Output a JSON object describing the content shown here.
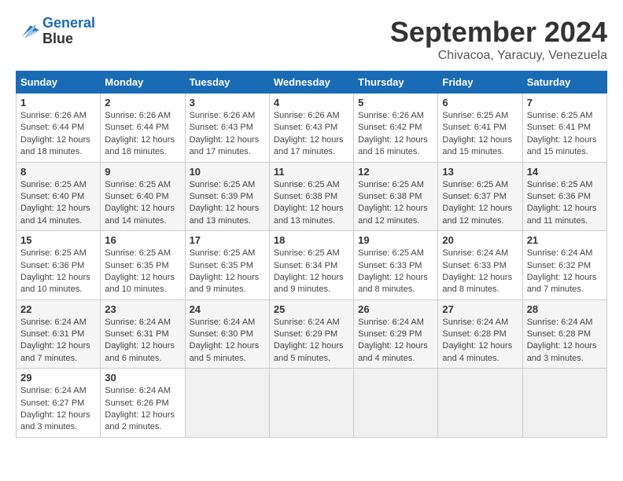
{
  "header": {
    "logo": "GeneralBlue",
    "month": "September 2024",
    "location": "Chivacoa, Yaracuy, Venezuela"
  },
  "days_of_week": [
    "Sunday",
    "Monday",
    "Tuesday",
    "Wednesday",
    "Thursday",
    "Friday",
    "Saturday"
  ],
  "weeks": [
    [
      {
        "day": "1",
        "sunrise": "6:26 AM",
        "sunset": "6:44 PM",
        "daylight": "12 hours and 18 minutes."
      },
      {
        "day": "2",
        "sunrise": "6:26 AM",
        "sunset": "6:44 PM",
        "daylight": "12 hours and 18 minutes."
      },
      {
        "day": "3",
        "sunrise": "6:26 AM",
        "sunset": "6:43 PM",
        "daylight": "12 hours and 17 minutes."
      },
      {
        "day": "4",
        "sunrise": "6:26 AM",
        "sunset": "6:43 PM",
        "daylight": "12 hours and 17 minutes."
      },
      {
        "day": "5",
        "sunrise": "6:26 AM",
        "sunset": "6:42 PM",
        "daylight": "12 hours and 16 minutes."
      },
      {
        "day": "6",
        "sunrise": "6:25 AM",
        "sunset": "6:41 PM",
        "daylight": "12 hours and 15 minutes."
      },
      {
        "day": "7",
        "sunrise": "6:25 AM",
        "sunset": "6:41 PM",
        "daylight": "12 hours and 15 minutes."
      }
    ],
    [
      {
        "day": "8",
        "sunrise": "6:25 AM",
        "sunset": "6:40 PM",
        "daylight": "12 hours and 14 minutes."
      },
      {
        "day": "9",
        "sunrise": "6:25 AM",
        "sunset": "6:40 PM",
        "daylight": "12 hours and 14 minutes."
      },
      {
        "day": "10",
        "sunrise": "6:25 AM",
        "sunset": "6:39 PM",
        "daylight": "12 hours and 13 minutes."
      },
      {
        "day": "11",
        "sunrise": "6:25 AM",
        "sunset": "6:38 PM",
        "daylight": "12 hours and 13 minutes."
      },
      {
        "day": "12",
        "sunrise": "6:25 AM",
        "sunset": "6:38 PM",
        "daylight": "12 hours and 12 minutes."
      },
      {
        "day": "13",
        "sunrise": "6:25 AM",
        "sunset": "6:37 PM",
        "daylight": "12 hours and 12 minutes."
      },
      {
        "day": "14",
        "sunrise": "6:25 AM",
        "sunset": "6:36 PM",
        "daylight": "12 hours and 11 minutes."
      }
    ],
    [
      {
        "day": "15",
        "sunrise": "6:25 AM",
        "sunset": "6:36 PM",
        "daylight": "12 hours and 10 minutes."
      },
      {
        "day": "16",
        "sunrise": "6:25 AM",
        "sunset": "6:35 PM",
        "daylight": "12 hours and 10 minutes."
      },
      {
        "day": "17",
        "sunrise": "6:25 AM",
        "sunset": "6:35 PM",
        "daylight": "12 hours and 9 minutes."
      },
      {
        "day": "18",
        "sunrise": "6:25 AM",
        "sunset": "6:34 PM",
        "daylight": "12 hours and 9 minutes."
      },
      {
        "day": "19",
        "sunrise": "6:25 AM",
        "sunset": "6:33 PM",
        "daylight": "12 hours and 8 minutes."
      },
      {
        "day": "20",
        "sunrise": "6:24 AM",
        "sunset": "6:33 PM",
        "daylight": "12 hours and 8 minutes."
      },
      {
        "day": "21",
        "sunrise": "6:24 AM",
        "sunset": "6:32 PM",
        "daylight": "12 hours and 7 minutes."
      }
    ],
    [
      {
        "day": "22",
        "sunrise": "6:24 AM",
        "sunset": "6:31 PM",
        "daylight": "12 hours and 7 minutes."
      },
      {
        "day": "23",
        "sunrise": "6:24 AM",
        "sunset": "6:31 PM",
        "daylight": "12 hours and 6 minutes."
      },
      {
        "day": "24",
        "sunrise": "6:24 AM",
        "sunset": "6:30 PM",
        "daylight": "12 hours and 5 minutes."
      },
      {
        "day": "25",
        "sunrise": "6:24 AM",
        "sunset": "6:29 PM",
        "daylight": "12 hours and 5 minutes."
      },
      {
        "day": "26",
        "sunrise": "6:24 AM",
        "sunset": "6:29 PM",
        "daylight": "12 hours and 4 minutes."
      },
      {
        "day": "27",
        "sunrise": "6:24 AM",
        "sunset": "6:28 PM",
        "daylight": "12 hours and 4 minutes."
      },
      {
        "day": "28",
        "sunrise": "6:24 AM",
        "sunset": "6:28 PM",
        "daylight": "12 hours and 3 minutes."
      }
    ],
    [
      {
        "day": "29",
        "sunrise": "6:24 AM",
        "sunset": "6:27 PM",
        "daylight": "12 hours and 3 minutes."
      },
      {
        "day": "30",
        "sunrise": "6:24 AM",
        "sunset": "6:26 PM",
        "daylight": "12 hours and 2 minutes."
      },
      null,
      null,
      null,
      null,
      null
    ]
  ]
}
